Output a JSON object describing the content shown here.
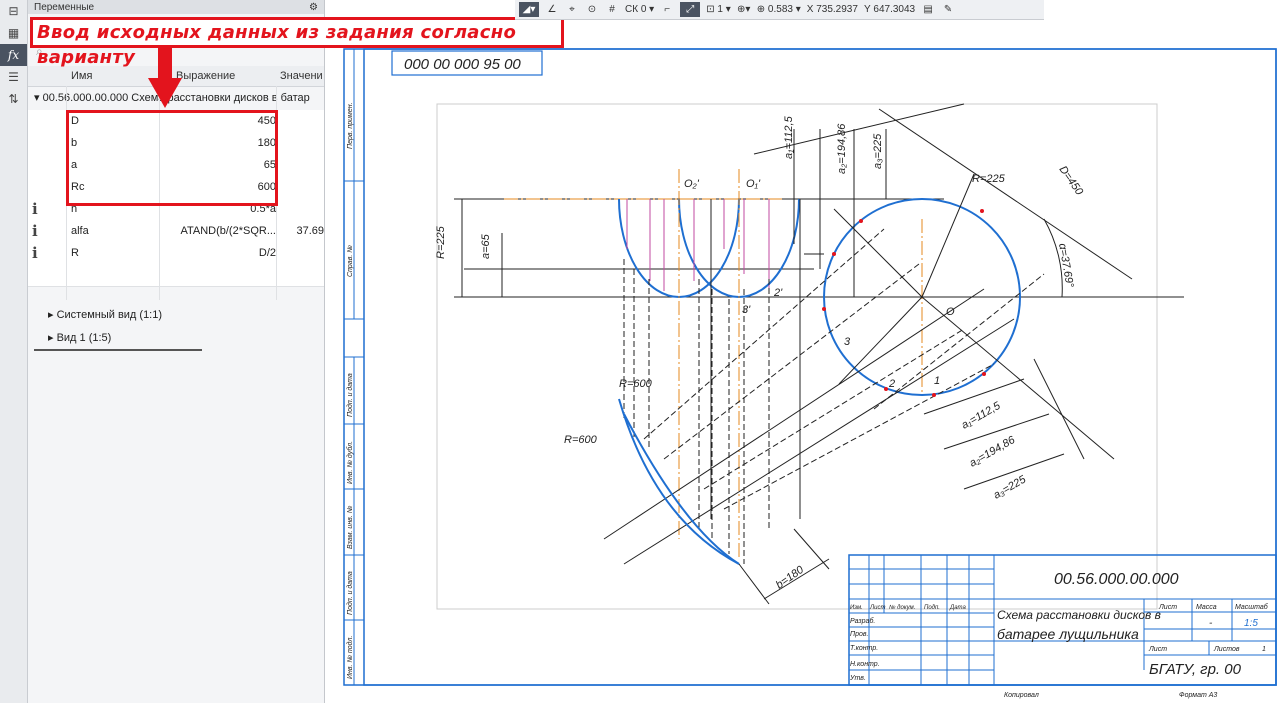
{
  "panel": {
    "title": "Переменные",
    "callout": "Ввод исходных данных из задания согласно варианту",
    "columns": {
      "name": "Имя",
      "expr": "Выражение",
      "value": "Значени"
    },
    "group_label": "▾ 00.56.000.00.000 Схема расстановки дисков в батар",
    "variables": [
      {
        "name": "D",
        "expr": "450",
        "value": "",
        "info": false
      },
      {
        "name": "b",
        "expr": "180",
        "value": "",
        "info": false
      },
      {
        "name": "a",
        "expr": "65",
        "value": "",
        "info": false
      },
      {
        "name": "Rc",
        "expr": "600",
        "value": "",
        "info": false
      },
      {
        "name": "h",
        "expr": "0.5*a",
        "value": "",
        "info": true
      },
      {
        "name": "alfa",
        "expr": "ATAND(b/(2*SQR...",
        "value": "37.69",
        "info": true
      },
      {
        "name": "R",
        "expr": "D/2",
        "value": "",
        "info": true
      }
    ],
    "views": [
      "▸ Системный вид (1:1)",
      "▸ Вид 1 (1:5)"
    ]
  },
  "toolbar": {
    "cs": "СК 0",
    "step": "1",
    "zoom": "0.583",
    "x_label": "X",
    "x_value": "735.2937",
    "y_label": "Y",
    "y_value": "647.3043"
  },
  "drawing": {
    "corner_code": "000 00 000 95 00",
    "code": "00.56.000.00.000",
    "title_line1": "Схема расстановки дисков в",
    "title_line2": "батарее лущильника",
    "org": "БГАТУ, гр. 00",
    "sheet_label": "Лист",
    "mass_label": "Масса",
    "scale_label": "Масштаб",
    "scale": "1:5",
    "mass": "-",
    "sheets_label": "Листов",
    "sheets": "1",
    "copied": "Копировал",
    "format": "Формат А3",
    "row_labels": [
      "Изм.",
      "Лист",
      "№ докум.",
      "Подп.",
      "Дата"
    ],
    "roles": [
      "Разраб.",
      "Пров.",
      "Т.контр.",
      "Н.контр.",
      "Утв."
    ],
    "side_labels": [
      "Перв. примен.",
      "Справ. №",
      "Подп. и дата",
      "Инв. № дубл.",
      "Взам. инв. №",
      "Подп. и дата",
      "Инв. № подл."
    ],
    "dims": {
      "D": "D=450",
      "R": "R=225",
      "a": "a=65",
      "Rc1": "R=600",
      "Rc2": "R=600",
      "b": "b=180",
      "alfa": "α=37.69°",
      "a1": "a₁=112,5",
      "a2": "a₂=194,86",
      "a3": "a₃=225",
      "O": "O",
      "O1": "O₁'",
      "O2": "O₂'",
      "p1": "1",
      "p2": "2",
      "p3": "3",
      "p2b": "2'",
      "p3b": "3'"
    }
  }
}
